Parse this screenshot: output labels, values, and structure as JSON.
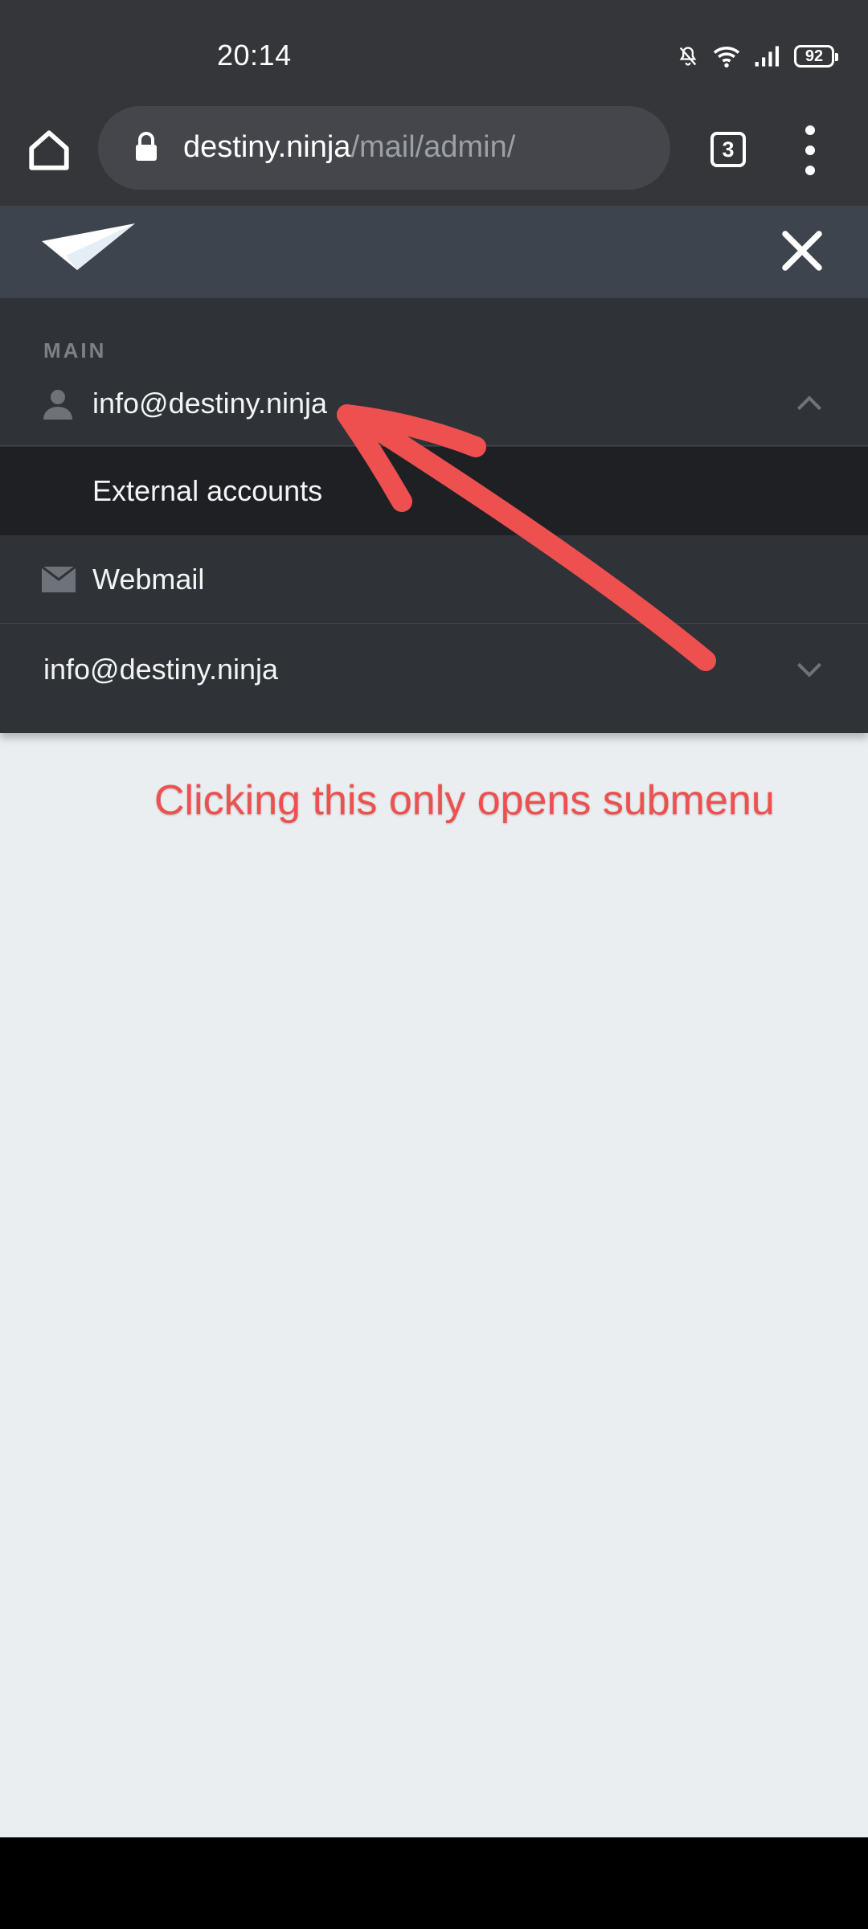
{
  "status_bar": {
    "time": "20:14",
    "battery_level": "92",
    "icons": [
      "mute-bell-icon",
      "wifi-icon",
      "signal-icon",
      "battery-icon"
    ]
  },
  "browser": {
    "url_domain": "destiny.ninja",
    "url_path": "/mail/admin/",
    "tab_count": "3",
    "icons": [
      "home-icon",
      "lock-icon",
      "tab-switcher-icon",
      "overflow-menu-icon"
    ]
  },
  "app": {
    "logo": "paper-plane-icon",
    "close_icon": "close-icon",
    "menu": {
      "section_label": "MAIN",
      "account_label": "info@destiny.ninja",
      "account_expanded": true,
      "submenu_item": "External accounts",
      "webmail_label": "Webmail",
      "user_label": "info@destiny.ninja"
    }
  },
  "annotation": {
    "text": "Clicking this only opens submenu",
    "color": "#ee5050"
  },
  "colors": {
    "browser_chrome": "#35363a",
    "nav_header": "#3e444d",
    "menu_bg": "#2f3237",
    "submenu_bg": "#1f2023",
    "page_bg": "#ebeef0"
  }
}
